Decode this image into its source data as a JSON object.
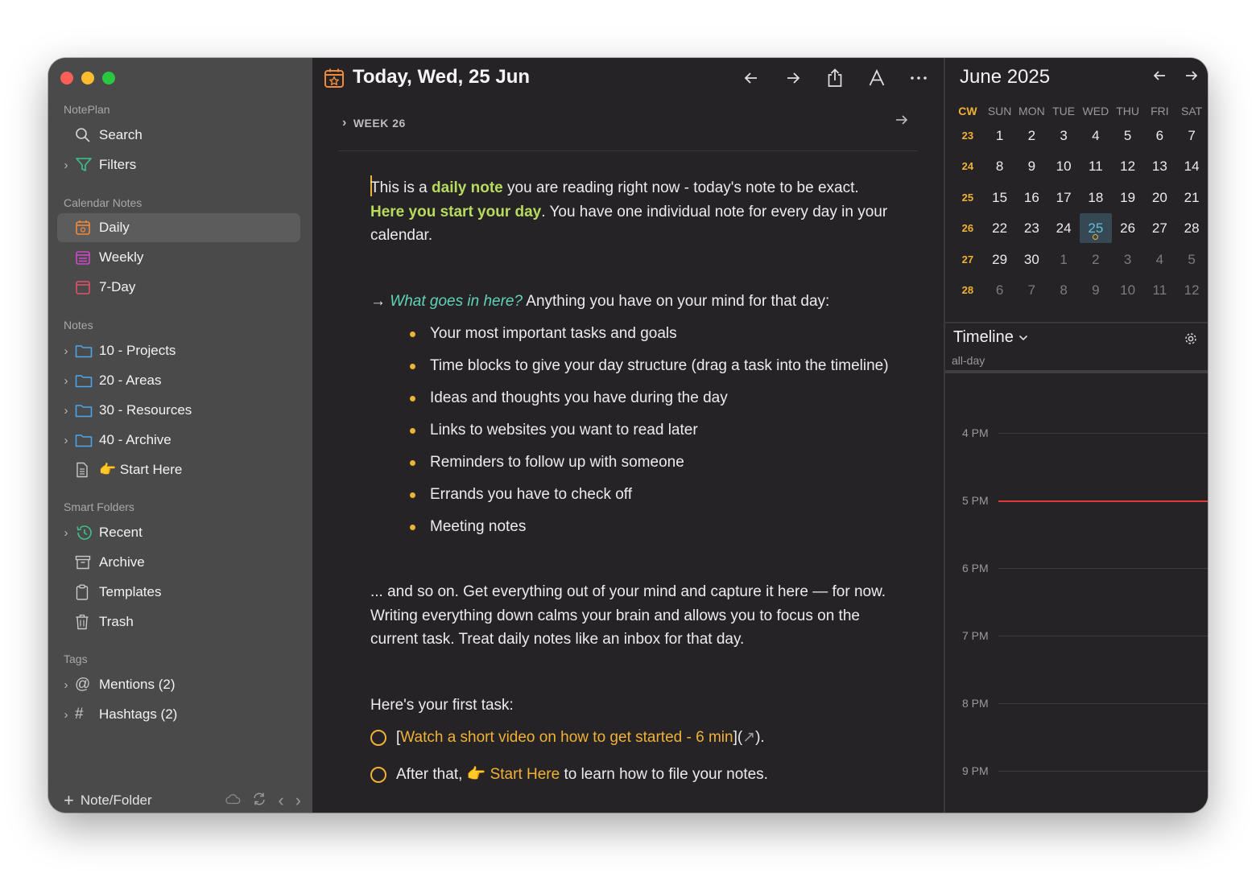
{
  "sidebar": {
    "app_name": "NotePlan",
    "search": "Search",
    "filters": "Filters",
    "calendar_notes_title": "Calendar Notes",
    "daily": "Daily",
    "weekly": "Weekly",
    "seven_day": "7-Day",
    "notes_title": "Notes",
    "folders": [
      "10 - Projects",
      "20 - Areas",
      "30 - Resources",
      "40 - Archive"
    ],
    "start_here": "👉 Start Here",
    "smart_folders_title": "Smart Folders",
    "recent": "Recent",
    "archive": "Archive",
    "templates": "Templates",
    "trash": "Trash",
    "tags_title": "Tags",
    "mentions": "Mentions (2)",
    "hashtags": "Hashtags (2)",
    "add_label": "Note/Folder"
  },
  "main": {
    "title": "Today, Wed, 25 Jun",
    "week_label": "WEEK 26",
    "p1_a": "This is a ",
    "p1_b": "daily note",
    "p1_c": " you are reading right now - today's note to be exact. ",
    "p1_d": "Here you start your day",
    "p1_e": ". You have one individual note for every day in your calendar.",
    "p2_arrow": "→ ",
    "p2_q": "What goes in here?",
    "p2_rest": " Anything you have on your mind for that day:",
    "bullets": [
      "Your most important tasks and goals",
      "Time blocks to give your day structure (drag a task into the timeline)",
      "Ideas and thoughts you have during the day",
      "Links to websites you want to read later",
      "Reminders to follow up with someone",
      "Errands you have to check off",
      "Meeting notes"
    ],
    "p3": "... and so on. Get everything out of your mind and capture it here — for now. Writing everything down calms your brain and allows you to focus on the current task. Treat daily notes like an inbox for that day.",
    "p4": "Here's your first task:",
    "task1_open": "[",
    "task1_link": "Watch a short video on how to get started - 6 min",
    "task1_close": "](",
    "task1_arrow": "↗",
    "task1_end": ").",
    "task2_a": "After that, ",
    "task2_link": "👉 Start Here",
    "task2_b": " to learn how to file your notes."
  },
  "calendar": {
    "month": "June 2025",
    "headers": [
      "CW",
      "SUN",
      "MON",
      "TUE",
      "WED",
      "THU",
      "FRI",
      "SAT"
    ],
    "weeks": [
      {
        "cw": "23",
        "days": [
          "1",
          "2",
          "3",
          "4",
          "5",
          "6",
          "7"
        ]
      },
      {
        "cw": "24",
        "days": [
          "8",
          "9",
          "10",
          "11",
          "12",
          "13",
          "14"
        ]
      },
      {
        "cw": "25",
        "days": [
          "15",
          "16",
          "17",
          "18",
          "19",
          "20",
          "21"
        ]
      },
      {
        "cw": "26",
        "days": [
          "22",
          "23",
          "24",
          "25",
          "26",
          "27",
          "28"
        ]
      },
      {
        "cw": "27",
        "days": [
          "29",
          "30",
          "1",
          "2",
          "3",
          "4",
          "5"
        ]
      },
      {
        "cw": "28",
        "days": [
          "6",
          "7",
          "8",
          "9",
          "10",
          "11",
          "12"
        ]
      }
    ],
    "today": "25"
  },
  "timeline": {
    "title": "Timeline",
    "all_day": "all-day",
    "hours": [
      "4 PM",
      "5 PM",
      "6 PM",
      "7 PM",
      "8 PM",
      "9 PM"
    ]
  },
  "colors": {
    "accent": "#f0b236",
    "highlight_green": "#b7db5e",
    "highlight_teal": "#5fd4b8",
    "now_line": "#e0393a",
    "sidebar_bg": "#4a4a4a",
    "main_bg": "#252325"
  }
}
